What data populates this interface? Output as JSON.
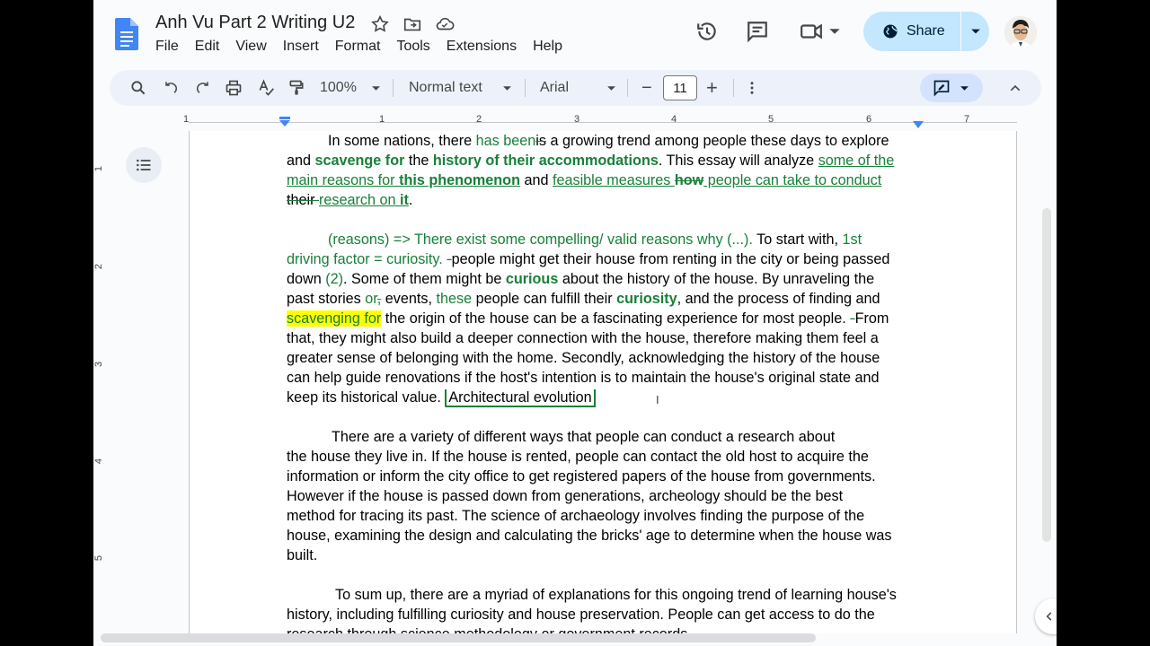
{
  "header": {
    "doc_title": "Anh Vu Part 2 Writing U2",
    "menu": [
      "File",
      "Edit",
      "View",
      "Insert",
      "Format",
      "Tools",
      "Extensions",
      "Help"
    ],
    "share_label": "Share"
  },
  "toolbar": {
    "zoom": "100%",
    "style": "Normal text",
    "font": "Arial",
    "font_size": "11",
    "minus": "−",
    "plus": "+"
  },
  "ruler": {
    "h_numbers": [
      "1",
      "1",
      "2",
      "3",
      "4",
      "5",
      "6",
      "7"
    ],
    "v_numbers": [
      "1",
      "2",
      "3",
      "4",
      "5"
    ]
  },
  "document": {
    "p1": {
      "l1a": "In some nations, there ",
      "l1b": "has been",
      "l1c": "is",
      "l1d": " a growing trend among people these days to explore",
      "l2a": "and ",
      "l2b": "scavenge for",
      "l2c": " the ",
      "l2d": "history of their accommodations",
      "l2e": ". This essay will analyze ",
      "l2f": "some of the",
      "l3a": "main reasons for ",
      "l3b": "this phenomenon",
      "l3c": " and ",
      "l3d": "feasible measures ",
      "l3e": "how",
      "l3f": " people can take to conduct",
      "l4a": "their ",
      "l4b": "research on ",
      "l4c": "it",
      "l4d": "."
    },
    "p2": {
      "l1a": "(reasons) => There exist some compelling/ valid reasons why (...). ",
      "l1b": "To start with, ",
      "l1c": "1st",
      "l2a": "driving factor = curiosity. ",
      "l2b": "-",
      "l2c": "people might get their house from renting in the city or being passed",
      "l3a": "down ",
      "l3b": "(2)",
      "l3c": ". Some of them might be ",
      "l3d": "curious",
      "l3e": " about the history of the house. By unraveling the",
      "l4a": "past stories ",
      "l4b": "or",
      "l4c": ",",
      "l4d": " events, ",
      "l4e": "these",
      "l4f": " people can fulfill their ",
      "l4g": "curiosity",
      "l4h": ", and the process of finding and",
      "l5a": "scavenging for",
      "l5b": " the origin of the house can be a fascinating experience for most people. ",
      "l5c": "-",
      "l5d": "From",
      "l6": "that, they might also build a deeper connection with the house, therefore making them feel a",
      "l7": "greater sense of belonging with the home. Secondly, acknowledging the history of the house",
      "l8": "can help guide renovations if the host's intention is to maintain the house's original state and",
      "l9a": "keep its historical value. ",
      "l9b": "Architectural evolution"
    },
    "p3": {
      "l1": "There are a variety of different ways that people can conduct a research about",
      "l2": "the house they live in. If the house is rented, people can contact the old host to acquire the",
      "l3": "information or inform the city office to get registered papers of the house from governments.",
      "l4": "However if the house is passed down from generations, archeology should be the best",
      "l5": "method for tracing its past. The science of archaeology involves finding the purpose of the",
      "l6": "house, examining the design and calculating the bricks' age to determine when the house was",
      "l7": "built."
    },
    "p4": {
      "l1": "To sum up, there are a myriad of explanations for this ongoing trend of learning house's",
      "l2": "history, including fulfilling curiosity and house preservation. People can get access to do the",
      "l3": "research through science methodology or government records."
    }
  },
  "colors": {
    "suggestion": "#188038",
    "highlight": "#ffff00",
    "share_bg": "#c2e7ff"
  }
}
